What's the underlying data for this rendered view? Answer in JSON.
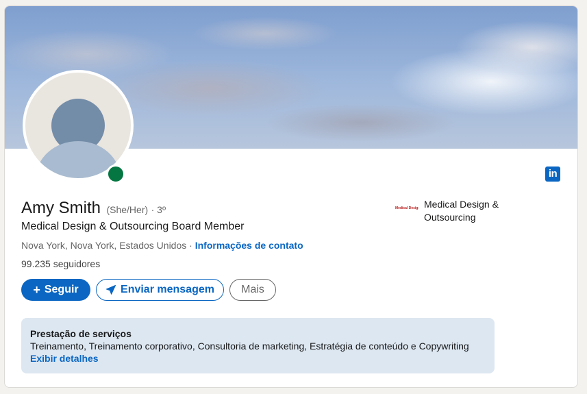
{
  "profile": {
    "name": "Amy Smith",
    "pronouns": "(She/Her)",
    "degree": "· 3º",
    "headline": "Medical Design & Outsourcing Board Member",
    "location": "Nova York, Nova York, Estados Unidos",
    "location_separator": " · ",
    "contact_link": "Informações de contato",
    "followers": "99.235 seguidores",
    "status": "online"
  },
  "company": {
    "name": "Medical Design & Outsourcing",
    "logo_text": "Medical Design"
  },
  "actions": {
    "follow_label": "Seguir",
    "follow_icon": "+",
    "message_label": "Enviar mensagem",
    "more_label": "Mais"
  },
  "services": {
    "title": "Prestação de serviços",
    "list": "Treinamento, Treinamento corporativo, Consultoria de marketing, Estratégia de conteúdo e Copywriting",
    "details_link": "Exibir detalhes"
  },
  "icons": {
    "brand": "linkedin-icon",
    "brand_text": "in",
    "message": "send-icon",
    "follow": "plus-icon"
  },
  "colors": {
    "accent": "#0a66c2",
    "online": "#057642",
    "services_bg": "#dde7f1"
  }
}
